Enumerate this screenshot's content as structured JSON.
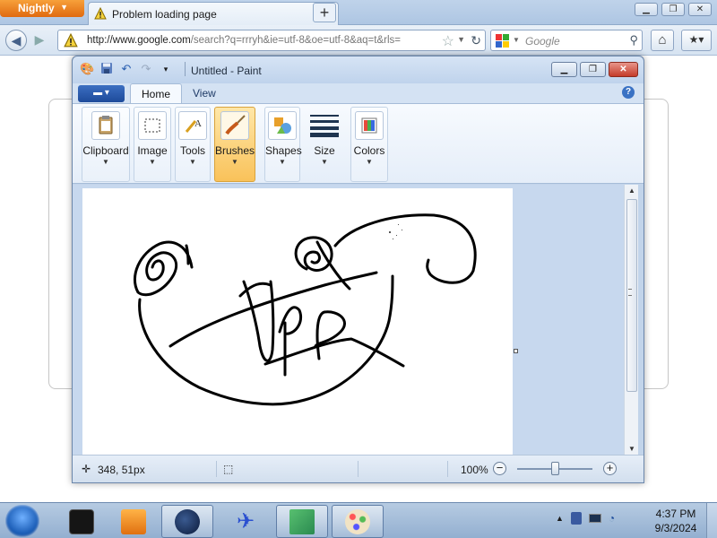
{
  "browser": {
    "menu_label": "Nightly",
    "tab_title": "Problem loading page",
    "url_host": "http://www.google.com",
    "url_path": "/search?q=rrryh&ie=utf-8&oe=utf-8&aq=t&rls=",
    "search_placeholder": "Google"
  },
  "paint": {
    "window_title": "Untitled - Paint",
    "tabs": [
      "Home",
      "View"
    ],
    "groups": [
      {
        "label": "Clipboard",
        "icon": "clipboard-icon"
      },
      {
        "label": "Image",
        "icon": "select-icon"
      },
      {
        "label": "Tools",
        "icon": "tools-icon"
      },
      {
        "label": "Brushes",
        "icon": "brush-icon",
        "active": true
      },
      {
        "label": "Shapes",
        "icon": "shapes-icon"
      },
      {
        "label": "Size",
        "icon": "size-icon"
      },
      {
        "label": "Colors",
        "icon": "colors-icon"
      }
    ],
    "status": {
      "cursor_position": "348, 51px",
      "zoom_level": "100%",
      "zoom_fraction": 0.5
    }
  },
  "taskbar": {
    "time": "4:37 PM",
    "date": "9/3/2024"
  },
  "colors": {
    "nightly_orange": "#e06a10",
    "ribbon_active": "#f9c25a",
    "close_red": "#c43c2a"
  }
}
